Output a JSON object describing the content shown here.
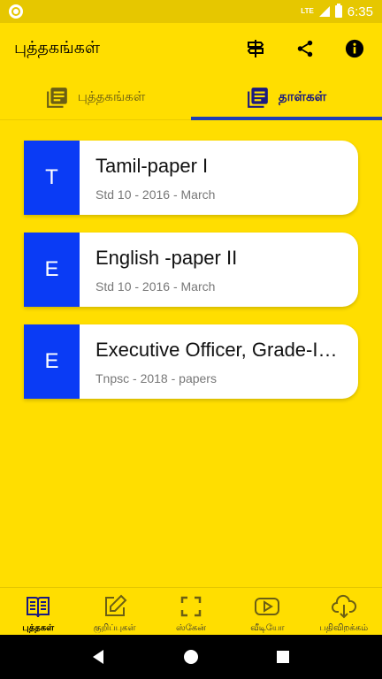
{
  "status": {
    "time": "6:35",
    "network": "LTE"
  },
  "app_bar": {
    "title": "புத்தகங்கள்"
  },
  "tabs": [
    {
      "label": "புத்தகங்கள்"
    },
    {
      "label": "தாள்கள்"
    }
  ],
  "papers": [
    {
      "letter": "T",
      "title": "Tamil-paper I",
      "subtitle": "Std 10 - 2016 - March"
    },
    {
      "letter": "E",
      "title": "English -paper II",
      "subtitle": "Std 10 - 2016 - March"
    },
    {
      "letter": "E",
      "title": "Executive Officer, Grade-I…",
      "subtitle": "Tnpsc - 2018 - papers"
    }
  ],
  "bottom_nav": [
    {
      "label": "புத்தகள்"
    },
    {
      "label": "குறிப்புகள்"
    },
    {
      "label": "ஸ்கேன்"
    },
    {
      "label": "வீடியோ"
    },
    {
      "label": "பதிவிறக்கம்"
    }
  ],
  "colors": {
    "background": "#FFDE00",
    "accent": "#0A3BF5",
    "active_tab": "#1A1A80"
  }
}
